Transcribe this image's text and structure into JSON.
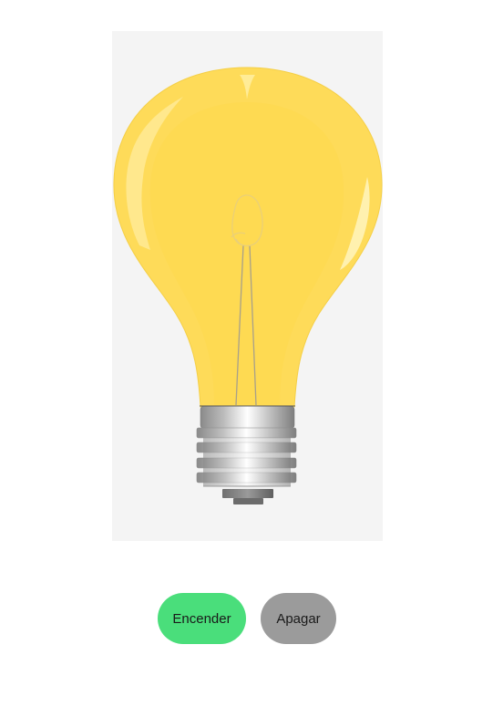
{
  "colors": {
    "panel_bg": "#f4f4f4",
    "bulb_glass": "#fedb59",
    "bulb_glass_inner": "#fdd94f",
    "filament": "#a8a08a",
    "socket_metal": "#b8b8b8",
    "on_button_bg": "#4ade7b",
    "off_button_bg": "#9b9b9b"
  },
  "bulb": {
    "state": "on",
    "icon": "light-bulb-icon"
  },
  "controls": {
    "on_label": "Encender",
    "off_label": "Apagar"
  }
}
